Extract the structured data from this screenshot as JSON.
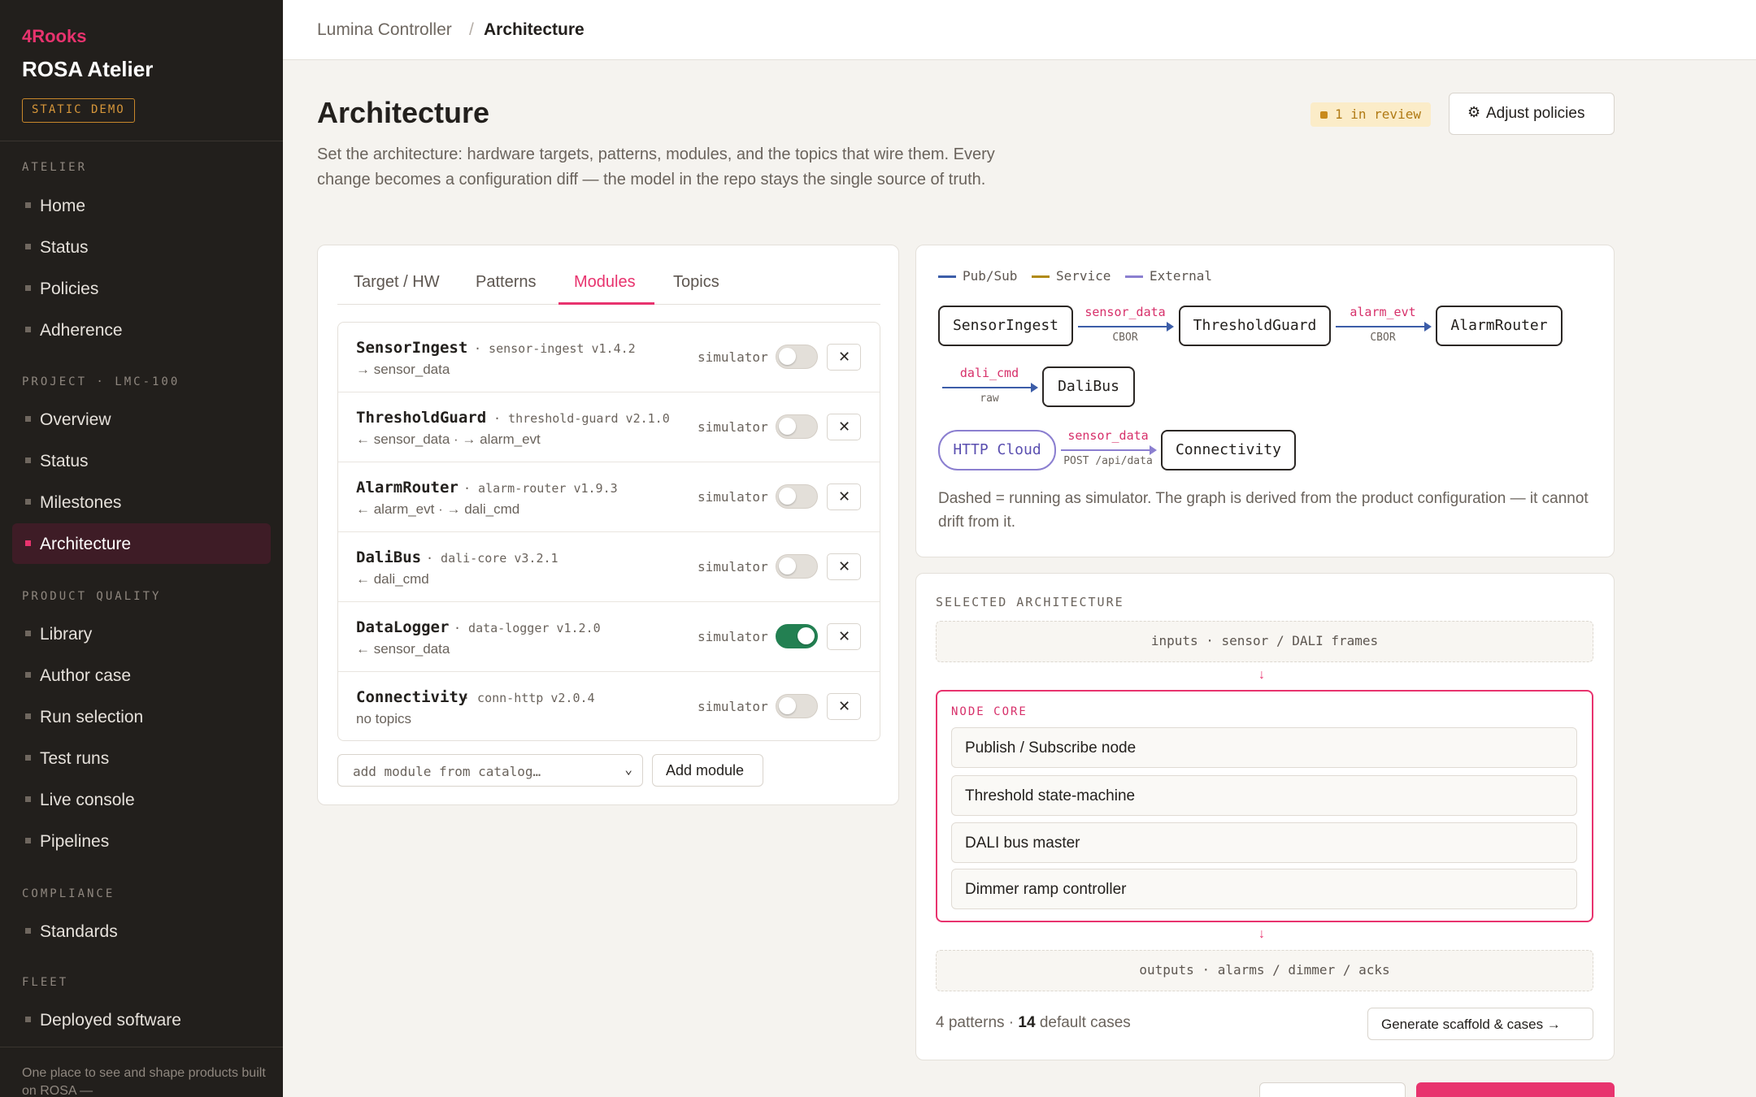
{
  "sidebar": {
    "brand": "4Rooks",
    "app_title": "ROSA Atelier",
    "badge": "STATIC DEMO",
    "sections": [
      {
        "title": "ATELIER",
        "items": [
          "Home",
          "Status",
          "Policies",
          "Adherence"
        ]
      },
      {
        "title": "PROJECT · LMC-100",
        "items": [
          "Overview",
          "Status",
          "Milestones",
          "Architecture"
        ]
      },
      {
        "title": "PRODUCT QUALITY",
        "items": [
          "Library",
          "Author case",
          "Run selection",
          "Test runs",
          "Live console",
          "Pipelines"
        ]
      },
      {
        "title": "COMPLIANCE",
        "items": [
          "Standards"
        ]
      },
      {
        "title": "FLEET",
        "items": [
          "Deployed software"
        ]
      }
    ],
    "active_item": "Architecture",
    "footer": "One place to see and shape products built on ROSA —"
  },
  "breadcrumb": {
    "root": "Lumina Controller",
    "separator": "/",
    "current": "Architecture"
  },
  "header": {
    "title": "Architecture",
    "description": "Set the architecture: hardware targets, patterns, modules, and the topics that wire them. Every change becomes a configuration diff — the model in the repo stays the single source of truth.",
    "review_badge": "1 in review",
    "adjust_button": "Adjust policies",
    "adjust_icon": "gear-icon"
  },
  "tabs": [
    "Target / HW",
    "Patterns",
    "Modules",
    "Topics"
  ],
  "active_tab": "Modules",
  "modules": [
    {
      "name": "SensorIngest",
      "package": "· sensor-ingest v1.4.2",
      "topics": "→ sensor_data",
      "sim_label": "simulator",
      "simulator": false
    },
    {
      "name": "ThresholdGuard",
      "package": "· threshold-guard v2.1.0",
      "topics": "← sensor_data · → alarm_evt",
      "sim_label": "simulator",
      "simulator": false
    },
    {
      "name": "AlarmRouter",
      "package": "· alarm-router v1.9.3",
      "topics": "← alarm_evt · → dali_cmd",
      "sim_label": "simulator",
      "simulator": false
    },
    {
      "name": "DaliBus",
      "package": "· dali-core v3.2.1",
      "topics": "← dali_cmd",
      "sim_label": "simulator",
      "simulator": false
    },
    {
      "name": "DataLogger",
      "package": "· data-logger v1.2.0",
      "topics": "← sensor_data",
      "sim_label": "simulator",
      "simulator": true
    },
    {
      "name": "Connectivity",
      "package": "· conn-http v2.0.4",
      "topics": "no topics",
      "sim_label": "simulator",
      "simulator": false
    }
  ],
  "catalog": {
    "placeholder": "add module from catalog…",
    "add_button": "Add module"
  },
  "graph": {
    "legend": [
      {
        "label": "Pub/Sub",
        "color": "#3c5da8"
      },
      {
        "label": "Service",
        "color": "#b08a14"
      },
      {
        "label": "External",
        "color": "#8b7fd0"
      }
    ],
    "nodes": [
      "SensorIngest",
      "ThresholdGuard",
      "AlarmRouter",
      "DaliBus",
      "HTTP Cloud",
      "Connectivity"
    ],
    "edges": [
      {
        "topic": "sensor_data",
        "encoding": "CBOR"
      },
      {
        "topic": "alarm_evt",
        "encoding": "CBOR"
      },
      {
        "topic": "dali_cmd",
        "encoding": "raw"
      },
      {
        "topic": "sensor_data",
        "encoding": "POST /api/data"
      }
    ],
    "note": "Dashed = running as simulator. The graph is derived from the product configuration — it cannot drift from it."
  },
  "selected": {
    "title": "SELECTED ARCHITECTURE",
    "inputs": "inputs · sensor / DALI frames",
    "arrow": "↓",
    "core_label": "NODE CORE",
    "core_items": [
      "Publish / Subscribe node",
      "Threshold state-machine",
      "DALI bus master",
      "Dimmer ramp controller"
    ],
    "outputs": "outputs · alarms / dimmer / acks",
    "patterns_count": "4",
    "patterns_label": "patterns ·",
    "cases_count": "14",
    "cases_label": "default cases",
    "generate_button": "Generate scaffold & cases →"
  },
  "colors": {
    "accent": "#e8336e",
    "sidebar_bg": "#221f1c",
    "toggle_on": "#238052"
  }
}
